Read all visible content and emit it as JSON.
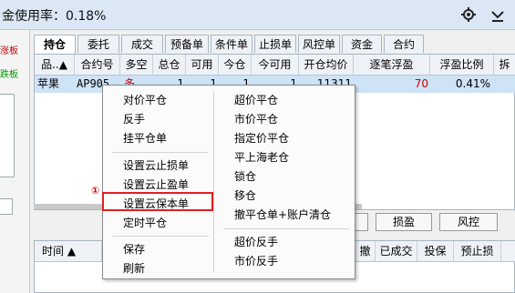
{
  "window": {
    "title": "金使用率：0.18%"
  },
  "left_panel": {
    "red_label": "涨板",
    "green_label": "跌板"
  },
  "tabs": [
    "持仓",
    "委托",
    "成交",
    "预备单",
    "条件单",
    "止损单",
    "风控单",
    "资金",
    "合约"
  ],
  "grid": {
    "columns": [
      "品..▲",
      "合约号",
      "多空",
      "总仓",
      "可用",
      "今仓",
      "今可用",
      "开仓均价",
      "逐笔浮盈",
      "浮盈比例",
      "拆"
    ],
    "rows": [
      {
        "product": "苹果",
        "contract": "AP905",
        "direction": "多",
        "total": "1",
        "available": "1",
        "today": "1",
        "today_avail": "1",
        "open_avg": "11311",
        "float_pnl": "70",
        "pnl_ratio": "0.41%"
      }
    ]
  },
  "buttons": {
    "profit_loss": "损盈",
    "risk": "风控"
  },
  "bottom_table": {
    "columns": [
      "时间 ▲",
      "撤",
      "已成交",
      "投保",
      "预止损"
    ]
  },
  "context_menu": {
    "left": [
      "对价平仓",
      "反手",
      "挂平仓单",
      "设置云止损单",
      "设置云止盈单",
      "设置云保本单",
      "定时平仓",
      "保存",
      "刷新"
    ],
    "right": [
      "超价平仓",
      "市价平仓",
      "指定价平仓",
      "平上海老仓",
      "锁仓",
      "移仓",
      "撤平仓单+账户清仓",
      "超价反手",
      "市价反手"
    ]
  },
  "annotation": {
    "marker": "①"
  },
  "colors": {
    "titlebar": "#dbe7f5",
    "selected_row": "#cfe3f7",
    "long": "#cc0000",
    "profit": "#cc0000",
    "highlight_border": "#e02020"
  }
}
